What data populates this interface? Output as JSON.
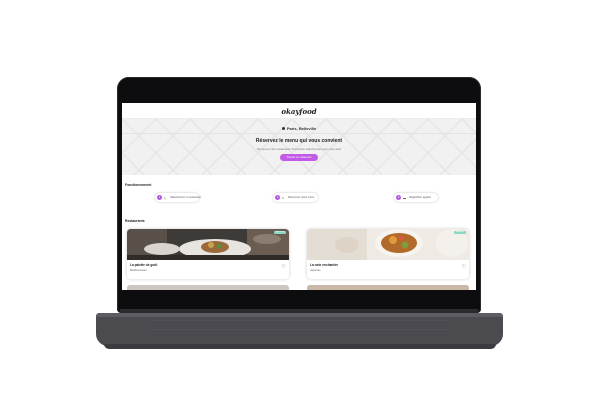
{
  "site": {
    "logo": "okayfood",
    "location": "Paris, Belleville",
    "hero_title": "Réservez le menu qui vous convient",
    "hero_subtitle": "Découvrez des restaurants d'exception sélectionnés pour vous ainsi",
    "hero_button": "Trouver un restaurant"
  },
  "sections": {
    "steps_label": "Fonctionnement",
    "restaurants_label": "Restaurants"
  },
  "steps": [
    {
      "number": "1",
      "icon": "phone-icon",
      "glyph": "▯",
      "label": "Sélectionnez un restaurant"
    },
    {
      "number": "2",
      "icon": "list-icon",
      "glyph": "≡",
      "label": "Découvrez notre menu"
    },
    {
      "number": "3",
      "icon": "card-icon",
      "glyph": "▬",
      "label": "Réglez/bon appétit"
    }
  ],
  "restaurants": [
    {
      "name": "La palette de goût",
      "type": "Méditerranéen",
      "tag": "Nouveau"
    },
    {
      "name": "La note enchantée",
      "type": "Japonais",
      "tag": "Nouveau"
    }
  ],
  "colors": {
    "accent": "#c15be6",
    "step_badge": "#b355e0",
    "tag": "#8fd6c4",
    "laptop_body": "#4a4a4f",
    "bezel": "#0d0d0f"
  }
}
